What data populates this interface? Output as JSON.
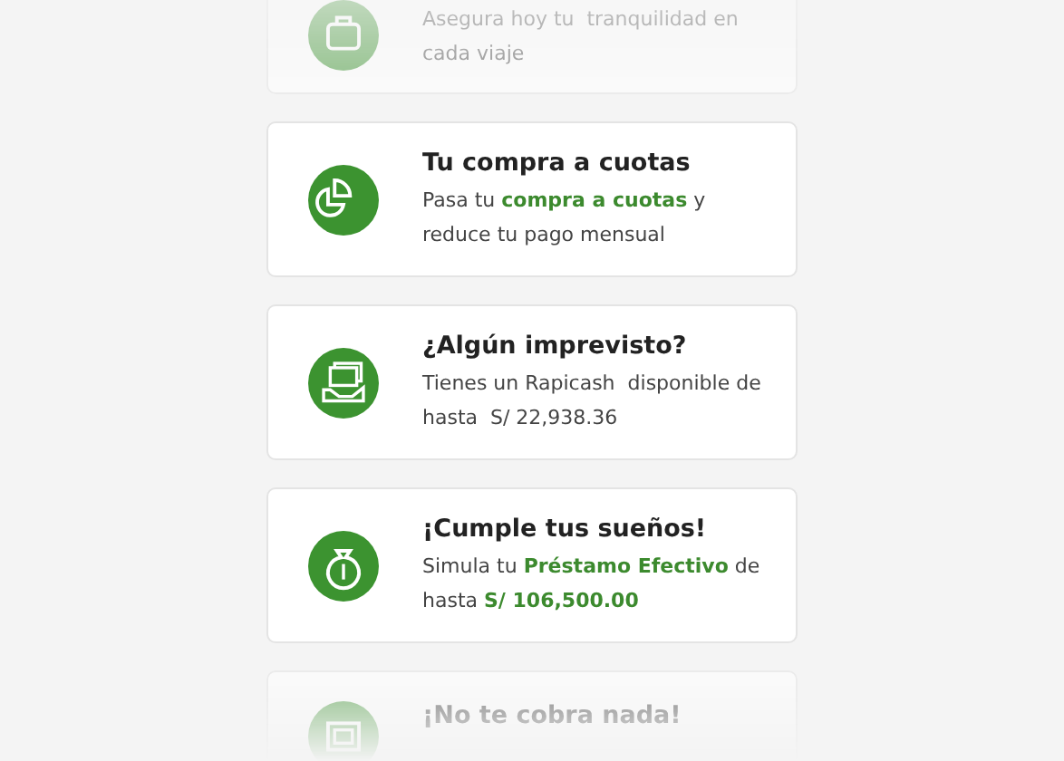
{
  "cards": [
    {
      "body": "Asegura hoy tu  tranquilidad en cada viaje"
    },
    {
      "title": "Tu compra a cuotas",
      "body": "Pasa tu **compra a cuotas** y reduce tu pago mensual"
    },
    {
      "title": "¿Algún imprevisto?",
      "body": "Tienes un Rapicash  disponible de hasta  S/ 22,938.36"
    },
    {
      "title": "¡Cumple tus sueños!",
      "body": "Simula tu **Préstamo Efectivo** de hasta **S/ 106,500.00**"
    },
    {
      "title": "¡No te cobra nada!"
    }
  ]
}
